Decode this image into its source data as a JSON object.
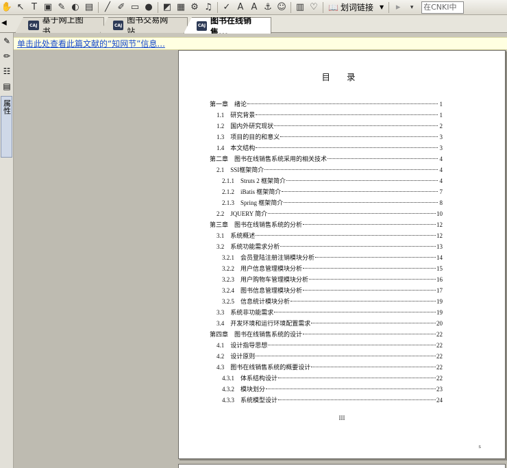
{
  "toolbar": {
    "icons": [
      "hand-icon",
      "select-arrow-icon",
      "text-select-icon",
      "snapshot-icon",
      "zoom-icon",
      "highlight-icon",
      "note-icon",
      "pencil-icon",
      "pen-icon",
      "rectangle-icon",
      "ellipse-icon",
      "stamp-icon",
      "image-icon",
      "gear-icon",
      "music-icon",
      "spellcheck-icon",
      "font-icon",
      "font-color-icon",
      "anchor-icon",
      "user-icon",
      "bookmark-icon",
      "heart-icon"
    ],
    "glyphs": [
      "✋",
      "↖",
      "T",
      "▣",
      "✎",
      "◐",
      "▤",
      "╱",
      "✐",
      "▭",
      "●",
      "◩",
      "▦",
      "⚙",
      "♫",
      "✓",
      "A",
      "A",
      "⚓",
      "☺",
      "▥",
      "♡"
    ],
    "link_label": "划词链接",
    "search_placeholder": "在CNKI中"
  },
  "tabs": [
    {
      "label": "基于网上图书...",
      "icon": "CAJ"
    },
    {
      "label": "图书交易网站...",
      "icon": "CAJ"
    },
    {
      "label": "图书在线销售...",
      "icon": "CAJ"
    }
  ],
  "side": {
    "tab_label": "属性"
  },
  "infobar": {
    "text": "单击此处查看此篇文献的“知网节”信息..."
  },
  "document": {
    "title": "目 录",
    "page_number": "III",
    "corner_mark": "s",
    "toc": [
      {
        "label": "第一章　绪论",
        "page": "1",
        "level": 0
      },
      {
        "label": "1.1　研究背景",
        "page": "1",
        "level": 1
      },
      {
        "label": "1.2　国内外研究现状",
        "page": "2",
        "level": 1
      },
      {
        "label": "1.3　项目的目的和意义",
        "page": "3",
        "level": 1
      },
      {
        "label": "1.4　本文结构",
        "page": "3",
        "level": 1
      },
      {
        "label": "第二章　图书在线销售系统采用的相关技术",
        "page": "4",
        "level": 0
      },
      {
        "label": "2.1　SSI框架简介",
        "page": "4",
        "level": 1
      },
      {
        "label": "2.1.1　Struts 2 框架简介",
        "page": "4",
        "level": 2
      },
      {
        "label": "2.1.2　iBatis 框架简介",
        "page": "7",
        "level": 2
      },
      {
        "label": "2.1.3　Spring 框架简介",
        "page": "8",
        "level": 2
      },
      {
        "label": "2.2　JQUERY 简介",
        "page": "10",
        "level": 1
      },
      {
        "label": "第三章　图书在线销售系统的分析",
        "page": "12",
        "level": 0
      },
      {
        "label": "3.1　系统概述",
        "page": "12",
        "level": 1
      },
      {
        "label": "3.2　系统功能需求分析",
        "page": "13",
        "level": 1
      },
      {
        "label": "3.2.1　会员登陆注册注销模块分析",
        "page": "14",
        "level": 2
      },
      {
        "label": "3.2.2　用户信息管理模块分析",
        "page": "15",
        "level": 2
      },
      {
        "label": "3.2.3　用户购物车管理模块分析",
        "page": "16",
        "level": 2
      },
      {
        "label": "3.2.4　图书信息管理模块分析",
        "page": "17",
        "level": 2
      },
      {
        "label": "3.2.5　信息统计模块分析",
        "page": "19",
        "level": 2
      },
      {
        "label": "3.3　系统非功能需求",
        "page": "19",
        "level": 1
      },
      {
        "label": "3.4　开发环境和运行环境配置需求",
        "page": "20",
        "level": 1
      },
      {
        "label": "第四章　图书在线销售系统的设计",
        "page": "22",
        "level": 0
      },
      {
        "label": "4.1　设计指导思想",
        "page": "22",
        "level": 1
      },
      {
        "label": "4.2　设计原则",
        "page": "22",
        "level": 1
      },
      {
        "label": "4.3　图书在线销售系统的概要设计",
        "page": "22",
        "level": 1
      },
      {
        "label": "4.3.1　体系结构设计",
        "page": "22",
        "level": 2
      },
      {
        "label": "4.3.2　模块划分",
        "page": "23",
        "level": 2
      },
      {
        "label": "4.3.3　系统模型设计",
        "page": "24",
        "level": 2
      }
    ]
  }
}
